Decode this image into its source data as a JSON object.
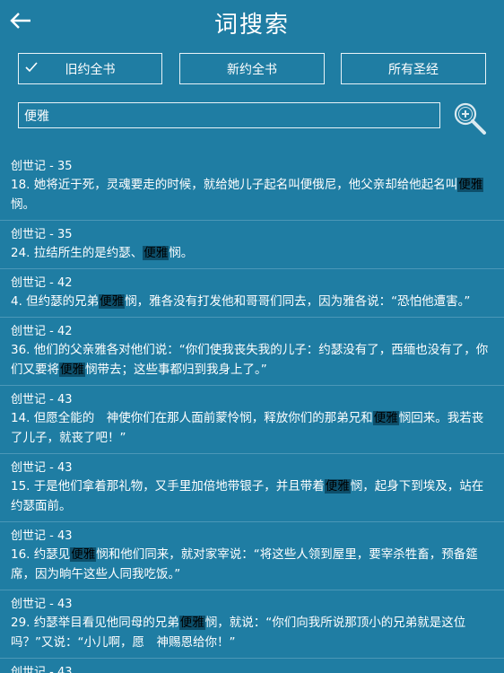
{
  "header": {
    "title": "词搜索"
  },
  "scopes": [
    {
      "label": "旧约全书",
      "selected": true
    },
    {
      "label": "新约全书",
      "selected": false
    },
    {
      "label": "所有圣经",
      "selected": false
    }
  ],
  "search": {
    "value": "便雅"
  },
  "results": [
    {
      "ref": "创世记 - 35",
      "parts": [
        "18. 她将近于死，灵魂要走的时候，就给她儿子起名叫便俄尼，他父亲却给他起名叫",
        "便雅",
        "悯。"
      ]
    },
    {
      "ref": "创世记 - 35",
      "parts": [
        "24. 拉结所生的是约瑟、",
        "便雅",
        "悯。"
      ]
    },
    {
      "ref": "创世记 - 42",
      "parts": [
        "4. 但约瑟的兄弟",
        "便雅",
        "悯，雅各没有打发他和哥哥们同去，因为雅各说：“恐怕他遭害。”"
      ]
    },
    {
      "ref": "创世记 - 42",
      "parts": [
        "36. 他们的父亲雅各对他们说：“你们使我丧失我的儿子：约瑟没有了，西缅也没有了，你们又要将",
        "便雅",
        "悯带去；这些事都归到我身上了。”"
      ]
    },
    {
      "ref": "创世记 - 43",
      "parts": [
        "14. 但愿全能的　神使你们在那人面前蒙怜悯，释放你们的那弟兄和",
        "便雅",
        "悯回来。我若丧了儿子，就丧了吧！”"
      ]
    },
    {
      "ref": "创世记 - 43",
      "parts": [
        "15. 于是他们拿着那礼物，又手里加倍地带银子，并且带着",
        "便雅",
        "悯，起身下到埃及，站在约瑟面前。"
      ]
    },
    {
      "ref": "创世记 - 43",
      "parts": [
        "16. 约瑟见",
        "便雅",
        "悯和他们同来，就对家宰说：“将这些人领到屋里，要宰杀牲畜，预备筵席，因为晌午这些人同我吃饭。”"
      ]
    },
    {
      "ref": "创世记 - 43",
      "parts": [
        "29. 约瑟举目看见他同母的兄弟",
        "便雅",
        "悯，就说：“你们向我所说那顶小的兄弟就是这位吗？”又说：“小儿啊，愿　神赐恩给你！”"
      ]
    },
    {
      "ref": "创世记 - 43",
      "parts": [
        ""
      ]
    }
  ]
}
